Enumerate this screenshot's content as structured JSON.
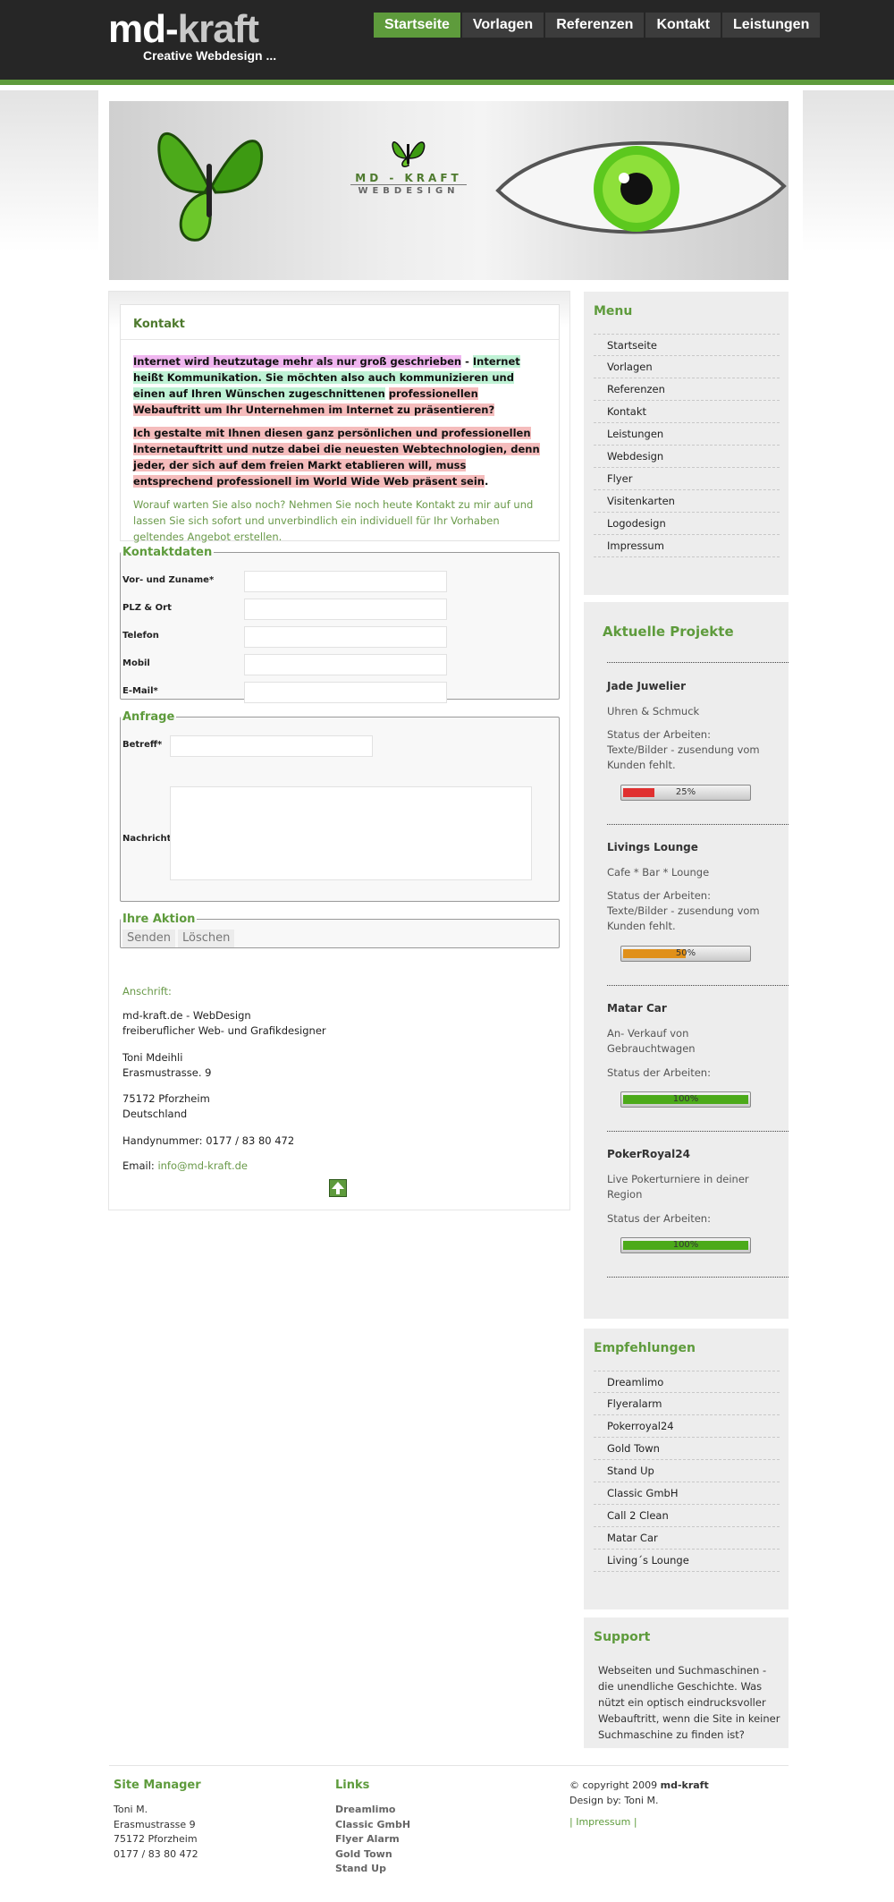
{
  "header": {
    "logo_main": "md-",
    "logo_accent": "kraft",
    "slogan": "Creative Webdesign ..."
  },
  "nav": [
    {
      "label": "Startseite",
      "active": true
    },
    {
      "label": "Vorlagen"
    },
    {
      "label": "Referenzen"
    },
    {
      "label": "Kontakt"
    },
    {
      "label": "Leistungen"
    }
  ],
  "banner": {
    "line1": "MD - KRAFT",
    "line2": "WEBDESIGN"
  },
  "main": {
    "title": "Kontakt",
    "p1": [
      {
        "text": "Internet wird heutzutage mehr als nur groß geschrieben",
        "hl": "pink"
      },
      {
        "text": " - ",
        "hl": ""
      },
      {
        "text": "Internet heißt Kommunikation. Sie möchten also auch kommunizieren und einen auf Ihren Wünschen zugeschnittenen",
        "hl": "green"
      },
      {
        "text": " ",
        "hl": ""
      },
      {
        "text": "professionellen Webauftritt um Ihr Unternehmen im Internet zu präsentieren?",
        "hl": "red"
      }
    ],
    "p2": [
      {
        "text": "Ich gestalte mit Ihnen diesen ganz persönlichen und professionellen Internetauftritt und nutze dabei die neuesten Webtechnologien, denn jeder, der sich auf dem freien Markt etablieren will, muss entsprechend professionell im World Wide Web präsent sein",
        "hl": "red"
      },
      {
        "text": ".",
        "hl": ""
      }
    ],
    "p3": "Worauf warten Sie also noch? Nehmen Sie noch heute Kontakt zu mir auf und lassen Sie sich sofort und unverbindlich ein individuell für Ihr Vorhaben geltendes Angebot erstellen."
  },
  "form": {
    "kontaktdaten_legend": "Kontaktdaten",
    "fields": [
      {
        "label": "Vor- und Zuname*"
      },
      {
        "label": "PLZ & Ort"
      },
      {
        "label": "Telefon"
      },
      {
        "label": "Mobil"
      },
      {
        "label": "E-Mail*"
      }
    ],
    "anfrage_legend": "Anfrage",
    "betreff_label": "Betreff*",
    "nachricht_label": "Nachricht*",
    "aktion_legend": "Ihre Aktion",
    "send_label": "Senden",
    "reset_label": "Löschen"
  },
  "address": {
    "heading": "Anschrift:",
    "l1": "md-kraft.de - WebDesign",
    "l2": "freiberuflicher Web- und Grafikdesigner",
    "l3": "Toni Mdeihli",
    "l4": "Erasmustrasse. 9",
    "l5": "75172 Pforzheim",
    "l6": "Deutschland",
    "phone": "Handynummer: 0177 / 83 80 472",
    "email_label": "Email: ",
    "email": "info@md-kraft.de"
  },
  "sidebar": {
    "menu_title": "Menu",
    "menu": [
      "Startseite",
      "Vorlagen",
      "Referenzen",
      "Kontakt",
      "Leistungen",
      "Webdesign",
      "Flyer",
      "Visitenkarten",
      "Logodesign",
      "Impressum"
    ],
    "projects_title": "Aktuelle Projekte",
    "projects": [
      {
        "name": "Jade Juwelier",
        "desc": "Uhren & Schmuck",
        "status": "Status der Arbeiten: Texte/Bilder - zusendung vom Kunden fehlt.",
        "progress": 25,
        "pct": "25%",
        "color": "#e03030"
      },
      {
        "name": "Livings Lounge",
        "desc": "Cafe * Bar * Lounge",
        "status": "Status der Arbeiten: Texte/Bilder - zusendung vom Kunden fehlt.",
        "progress": 50,
        "pct": "50%",
        "color": "#e0901a"
      },
      {
        "name": "Matar Car",
        "desc": "An- Verkauf von Gebrauchtwagen",
        "status": "Status der Arbeiten:",
        "progress": 100,
        "pct": "100%",
        "color": "#4caa1a"
      },
      {
        "name": "PokerRoyal24",
        "desc": "Live Pokerturniere in deiner Region",
        "status": "Status der Arbeiten:",
        "progress": 100,
        "pct": "100%",
        "color": "#4caa1a"
      }
    ],
    "emp_title": "Empfehlungen",
    "emp": [
      "Dreamlimo",
      "Flyeralarm",
      "Pokerroyal24",
      "Gold Town",
      "Stand Up",
      "Classic GmbH",
      "Call 2 Clean",
      "Matar Car",
      "Living´s Lounge"
    ],
    "support_title": "Support",
    "support_text": "Webseiten und Suchmaschinen - die unendliche Geschichte. Was nützt ein optisch eindrucksvoller Webauftritt, wenn die Site in keiner Suchmaschine zu finden ist?"
  },
  "footer": {
    "sm_title": "Site Manager",
    "sm": [
      "Toni M.",
      "Erasmustrasse 9",
      "75172 Pforzheim",
      "0177 / 83 80 472"
    ],
    "links_title": "Links",
    "links": [
      "Dreamlimo",
      "Classic GmbH",
      "Flyer Alarm",
      "Gold Town",
      "Stand Up"
    ],
    "copy_prefix": "© copyright 2009 ",
    "copy_brand": "md-kraft",
    "design": "Design by: Toni M.",
    "impressum": "| Impressum |"
  }
}
